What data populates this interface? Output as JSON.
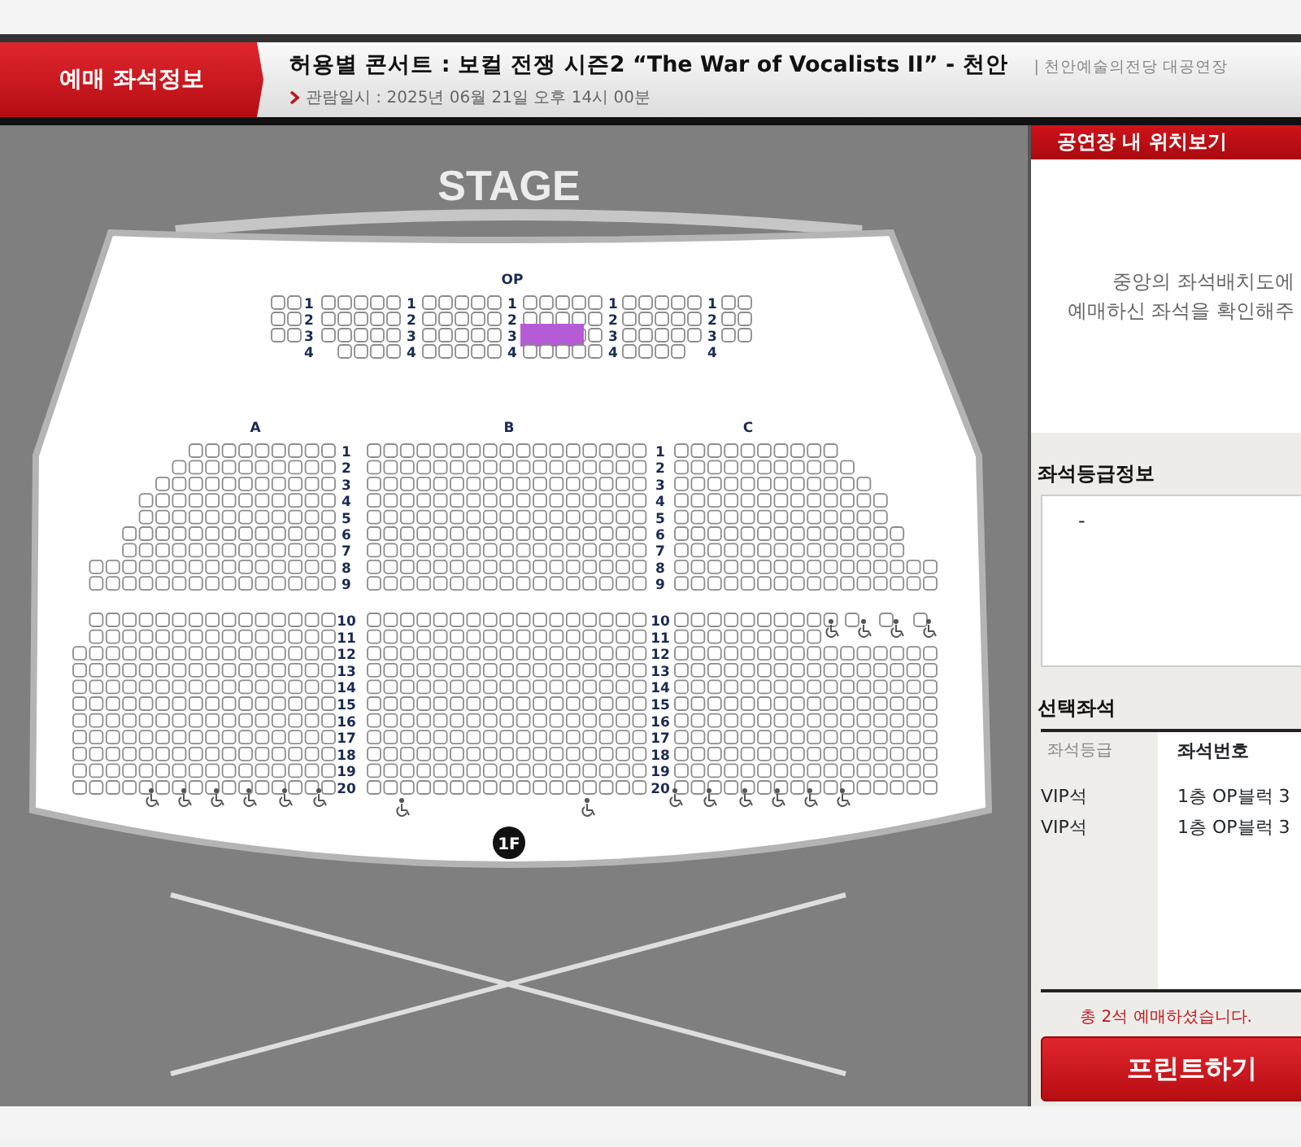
{
  "header": {
    "section_label": "예매 좌석정보",
    "title": "허용별 콘서트 : 보컬 전쟁 시즌2 “The War of Vocalists II” - 천안",
    "venue": "| 천안예술의전당 대공연장",
    "date": "관람일시 : 2025년 06월 21일 오후 14시 00분"
  },
  "seat_map": {
    "stage": "STAGE",
    "op_block": {
      "label": "OP",
      "rows": [
        {
          "labels": [
            "1",
            "1",
            "1",
            "1",
            "1"
          ],
          "selected": false
        },
        {
          "labels": [
            "2",
            "2",
            "2",
            "2",
            "2"
          ],
          "selected": false
        },
        {
          "labels": [
            "3",
            "3",
            "3",
            "3",
            "3"
          ],
          "selected": true
        },
        {
          "labels": [
            "4",
            "4",
            "4",
            "4",
            "4"
          ],
          "selected": false
        }
      ]
    },
    "sections": [
      "A",
      "B",
      "C"
    ],
    "rows": [
      {
        "left_label": "1",
        "right_label": "1"
      },
      {
        "left_label": "2",
        "right_label": "2"
      },
      {
        "left_label": "3",
        "right_label": "3"
      },
      {
        "left_label": "4",
        "right_label": "4"
      },
      {
        "left_label": "5",
        "right_label": "5"
      },
      {
        "left_label": "6",
        "right_label": "6"
      },
      {
        "left_label": "7",
        "right_label": "7"
      },
      {
        "left_label": "8",
        "right_label": "8"
      },
      {
        "left_label": "9",
        "right_label": "9"
      },
      {
        "left_label": "10",
        "right_label": "10"
      },
      {
        "left_label": "11",
        "right_label": "11"
      },
      {
        "left_label": "12",
        "right_label": "12"
      },
      {
        "left_label": "13",
        "right_label": "13"
      },
      {
        "left_label": "14",
        "right_label": "14"
      },
      {
        "left_label": "15",
        "right_label": "15"
      },
      {
        "left_label": "16",
        "right_label": "16"
      },
      {
        "left_label": "17",
        "right_label": "17"
      },
      {
        "left_label": "18",
        "right_label": "18"
      },
      {
        "left_label": "19",
        "right_label": "19"
      },
      {
        "left_label": "20",
        "right_label": "20"
      }
    ],
    "floor": "1F"
  },
  "location_panel": {
    "title": "공연장 내 위치보기",
    "message_lines": [
      "중앙의 좌석배치도에",
      "예매하신 좌석을 확인해주"
    ]
  },
  "grade_info": {
    "title": "좌석등급정보",
    "value": "-"
  },
  "selected_seats": {
    "title": "선택좌석",
    "columns": [
      "좌석등급",
      "좌석번호"
    ],
    "rows": [
      {
        "grade": "VIP석",
        "seat": "1층 OP블럭 3"
      },
      {
        "grade": "VIP석",
        "seat": "1층 OP블럭 3"
      }
    ]
  },
  "summary": "총 2석 예매하셨습니다.",
  "print_button": "프린트하기"
}
